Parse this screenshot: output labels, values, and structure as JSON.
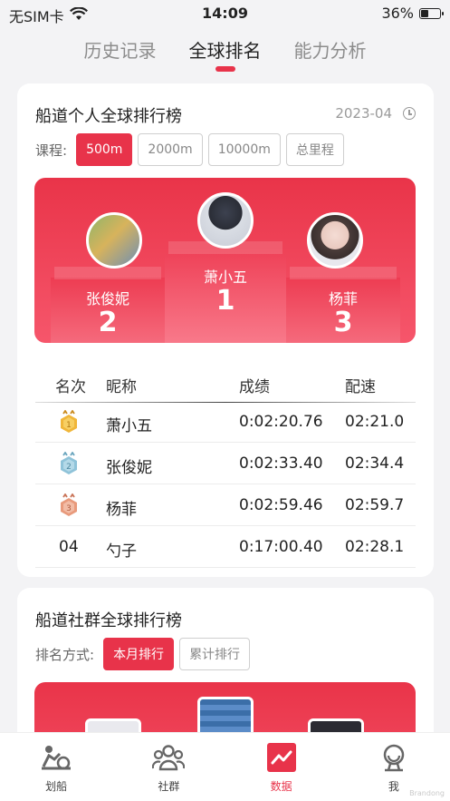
{
  "status": {
    "carrier": "无SIM卡",
    "time": "14:09",
    "battery": "36%",
    "battery_level": 0.36
  },
  "tabs": [
    {
      "label": "历史记录",
      "active": false
    },
    {
      "label": "全球排名",
      "active": true
    },
    {
      "label": "能力分析",
      "active": false
    }
  ],
  "personal": {
    "title": "船道个人全球排行榜",
    "date": "2023-04",
    "course_label": "课程:",
    "courses": [
      "500m",
      "2000m",
      "10000m",
      "总里程"
    ],
    "podium": [
      {
        "name": "萧小五",
        "rank": "1"
      },
      {
        "name": "张俊妮",
        "rank": "2"
      },
      {
        "name": "杨菲",
        "rank": "3"
      }
    ],
    "headers": {
      "rank": "名次",
      "name": "昵称",
      "time": "成绩",
      "pace": "配速"
    },
    "rows": [
      {
        "rank": "1",
        "name": "萧小五",
        "time": "0:02:20.76",
        "pace": "02:21.0"
      },
      {
        "rank": "2",
        "name": "张俊妮",
        "time": "0:02:33.40",
        "pace": "02:34.4"
      },
      {
        "rank": "3",
        "name": "杨菲",
        "time": "0:02:59.46",
        "pace": "02:59.7"
      },
      {
        "rank": "04",
        "name": "勺子",
        "time": "0:17:00.40",
        "pace": "02:28.1"
      }
    ]
  },
  "community": {
    "title": "船道社群全球排行榜",
    "sort_label": "排名方式:",
    "sorts": [
      "本月排行",
      "累计排行"
    ]
  },
  "nav": [
    {
      "label": "划船",
      "icon": "rowing-icon"
    },
    {
      "label": "社群",
      "icon": "group-icon"
    },
    {
      "label": "数据",
      "icon": "chart-icon",
      "active": true
    },
    {
      "label": "我",
      "icon": "user-icon"
    }
  ],
  "colors": {
    "accent": "#e8334a",
    "gold": "#f0b63a",
    "silver": "#8fc3d9",
    "bronze": "#e89a7c"
  },
  "watermark": "Brandong"
}
